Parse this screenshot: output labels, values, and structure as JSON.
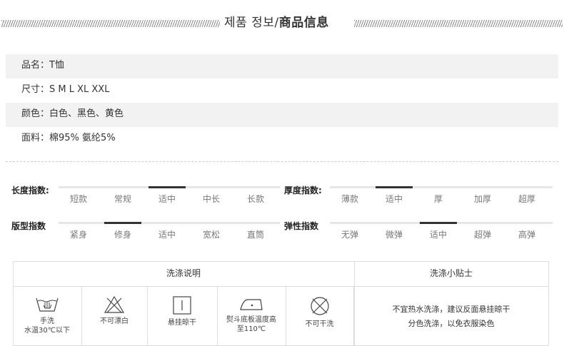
{
  "header": {
    "title_plain": "제품 정보/",
    "title_bold": "商品信息"
  },
  "info": [
    {
      "label": "品名：",
      "value": "T恤"
    },
    {
      "label": "尺寸：",
      "value": "S M L XL XXL"
    },
    {
      "label": "颜色：",
      "value": "白色、黑色、黄色"
    },
    {
      "label": "面料：",
      "value": "棉95% 氨纶5%"
    }
  ],
  "scales": {
    "length": {
      "label": "长度指数:",
      "options": [
        "短款",
        "常规",
        "适中",
        "中长",
        "长款"
      ],
      "selected": 2
    },
    "fit": {
      "label": "版型指数",
      "options": [
        "紧身",
        "修身",
        "适中",
        "宽松",
        "直筒"
      ],
      "selected": 1
    },
    "thickness": {
      "label": "厚度指数:",
      "options": [
        "薄款",
        "适中",
        "厚",
        "加厚",
        "超厚"
      ],
      "selected": 1
    },
    "elasticity": {
      "label": "弹性指数",
      "options": [
        "无弹",
        "微弹",
        "适中",
        "超弹",
        "高弹"
      ],
      "selected": 2
    }
  },
  "washing": {
    "title": "洗涤说明",
    "tips_title": "洗涤小贴士",
    "items": [
      {
        "icon": "hand-wash-icon",
        "line1": "手洗",
        "line2": "水温30℃以下"
      },
      {
        "icon": "no-bleach-icon",
        "line1": "不可漂白",
        "line2": ""
      },
      {
        "icon": "hang-dry-icon",
        "line1": "悬挂晾干",
        "line2": ""
      },
      {
        "icon": "iron-icon",
        "line1": "熨斗底板温度高",
        "line2": "至110℃"
      },
      {
        "icon": "no-dry-clean-icon",
        "line1": "不可干洗",
        "line2": ""
      }
    ],
    "tips": [
      "不宜热水洗涤，建议反面悬挂晾干",
      "分色洗涤，以免衣服染色"
    ]
  }
}
